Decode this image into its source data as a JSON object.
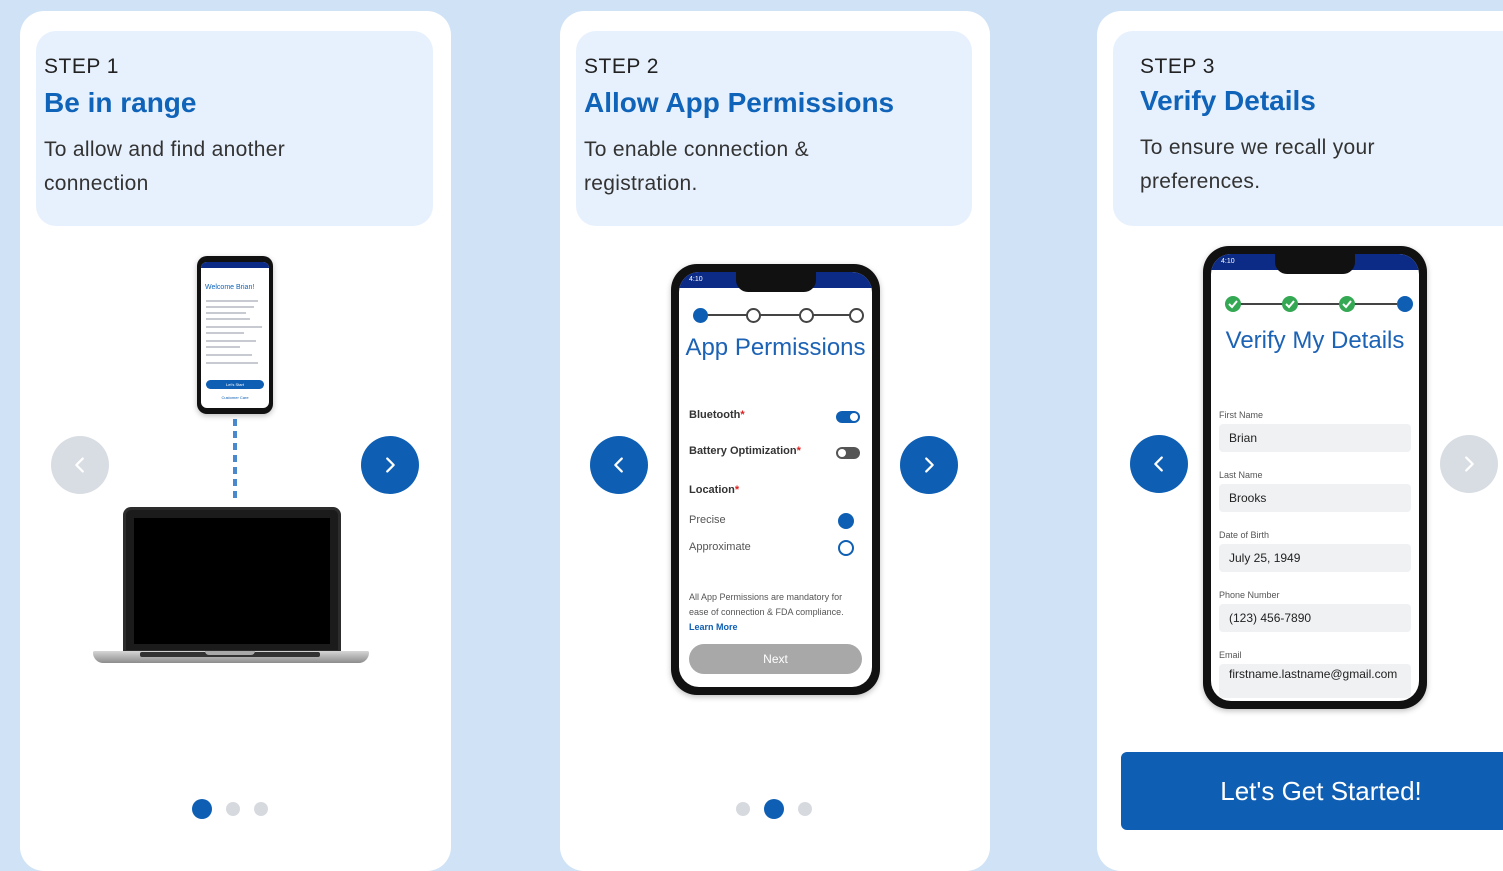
{
  "cards": [
    {
      "step": "STEP 1",
      "title": "Be in range",
      "description": "To allow and find another connection",
      "phone": {
        "welcome": "Welcome Brian!",
        "primary_button": "Let's Start",
        "link": "Customer Care"
      }
    },
    {
      "step": "STEP 2",
      "title": "Allow App Permissions",
      "description": "To enable connection & registration.",
      "phone": {
        "title": "App Permissions",
        "bluetooth_label": "Bluetooth",
        "battery_label": "Battery Optimization",
        "location_label": "Location",
        "required_mark": "*",
        "precise_label": "Precise",
        "approximate_label": "Approximate",
        "note": "All App Permissions are mandatory for ease of connection & FDA compliance.",
        "learn_more": "Learn More",
        "next_button": "Next",
        "bluetooth_on": true,
        "battery_on": false,
        "location_selected": "Precise",
        "status_time": "4:10"
      }
    },
    {
      "step": "STEP 3",
      "title": "Verify Details",
      "description": "To ensure we recall your preferences.",
      "phone": {
        "title": "Verify My Details",
        "status_time": "4:10",
        "fields": [
          {
            "label": "First Name",
            "value": "Brian"
          },
          {
            "label": "Last Name",
            "value": "Brooks"
          },
          {
            "label": "Date of Birth",
            "value": "July 25, 1949"
          },
          {
            "label": "Phone Number",
            "value": "(123) 456-7890"
          },
          {
            "label": "Email",
            "value": "firstname.lastname@gmail.com"
          }
        ]
      },
      "cta": "Let's Get Started!"
    }
  ],
  "pagination": {
    "total": 3
  },
  "colors": {
    "accent": "#0e5fb4",
    "background": "#cfe2f6",
    "header_bg": "#e7f1fd",
    "title": "#0f63b8",
    "check": "#34a853",
    "disabled": "#d8dde3"
  }
}
